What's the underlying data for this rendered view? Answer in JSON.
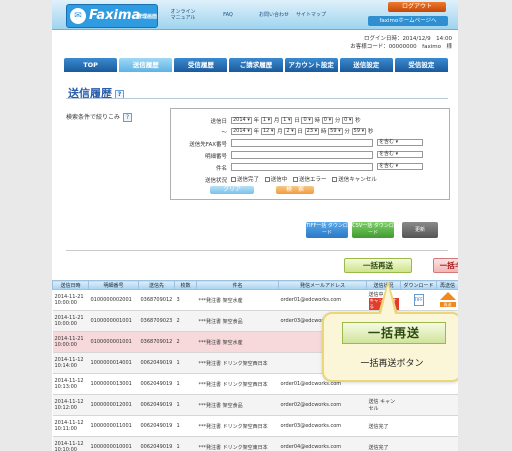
{
  "header": {
    "logo_main": "Faxima",
    "logo_sub": "管理画面",
    "nav": [
      "オンライン マニュアル",
      "FAQ",
      "お問い合わせ",
      "サイトマップ"
    ],
    "logout": "ログアウト",
    "home": "faximoホームページへ",
    "login_datetime": "ログイン日時：2014/12/9　14:00",
    "customer": "お客様コード：00000000　faximo　様"
  },
  "tabs": [
    "TOP",
    "送信履歴",
    "受信履歴",
    "ご請求履歴",
    "アカウント設定",
    "送信設定",
    "受信設定"
  ],
  "page": {
    "title": "送信履歴",
    "filter_label": "検索条件で絞りこみ"
  },
  "search": {
    "date_label": "送信日",
    "from": {
      "year": "2014",
      "month": "1",
      "day": "1",
      "hour": "0",
      "min": "0",
      "sec": "0"
    },
    "to": {
      "year": "2014",
      "month": "12",
      "day": "2",
      "hour": "23",
      "min": "59",
      "sec": "59"
    },
    "tilde": "～",
    "unit_year": "年",
    "unit_month": "月",
    "unit_day": "日",
    "unit_hour": "時",
    "unit_min": "分",
    "unit_sec": "秒",
    "fax_label": "送信先FAX番号",
    "detail_label": "明細番号",
    "subject_label": "件名",
    "contains": "を含む",
    "status_label": "送信状況",
    "statuses": [
      "送信完了",
      "送信中",
      "送信エラー",
      "送信キャンセル"
    ],
    "clear": "クリア",
    "search_btn": "検　索"
  },
  "downloads": {
    "tiff": "TIFF一括 ダウンロード",
    "csv": "CSV一括 ダウンロード",
    "refresh": "更新"
  },
  "actions": {
    "bulk_resend": "一括再送",
    "bulk_cancel": "一括キャンセル"
  },
  "table": {
    "headers": [
      "送信日時",
      "明細番号",
      "送信先",
      "枚数",
      "件名",
      "発信メールアドレス",
      "送信状況",
      "ダウンロード",
      "再送信"
    ],
    "rows": [
      {
        "date": "2014-11-21 10:00:00",
        "id": "0100000002001",
        "to": "0368709012",
        "pages": "3",
        "subject": "***発注書 架空水産",
        "mail": "order01@edcworks.com",
        "status": "送信中",
        "status_tag": "キャンセルする",
        "tiff": true,
        "resend": true,
        "hl": false
      },
      {
        "date": "2014-11-21 10:00:00",
        "id": "0100000001001",
        "to": "0368709023",
        "pages": "2",
        "subject": "***発注書 架空食品",
        "mail": "order03@edcworks.com",
        "status": "",
        "status_tag": "",
        "tiff": true,
        "resend": true,
        "hl": false
      },
      {
        "date": "2014-11-21 10:00:00",
        "id": "0100000001001",
        "to": "0368709012",
        "pages": "2",
        "subject": "***発注書 架空水産",
        "mail": "",
        "status": "",
        "status_tag": "",
        "tiff": true,
        "resend": true,
        "hl": true
      },
      {
        "date": "2014-11-12 10:14:00",
        "id": "1000000014001",
        "to": "0062049019",
        "pages": "1",
        "subject": "***発注書 ドリンク架空西日本",
        "mail": "",
        "status": "",
        "status_tag": "",
        "tiff": false,
        "resend": false,
        "hl": false
      },
      {
        "date": "2014-11-12 10:13:00",
        "id": "1000000013001",
        "to": "0062049019",
        "pages": "1",
        "subject": "***発注書 ドリンク架空西日本",
        "mail": "order01@edcworks.com",
        "status": "",
        "status_tag": "",
        "tiff": false,
        "resend": false,
        "hl": false
      },
      {
        "date": "2014-11-12 10:12:00",
        "id": "1000000012001",
        "to": "0062049019",
        "pages": "1",
        "subject": "***発注書 架空食品",
        "mail": "order02@edcworks.com",
        "status": "送信 キャンセル",
        "status_tag": "",
        "tiff": false,
        "resend": false,
        "hl": false
      },
      {
        "date": "2014-11-12 10:11:00",
        "id": "1000000011001",
        "to": "0062049019",
        "pages": "1",
        "subject": "***発注書 ドリンク架空西日本",
        "mail": "order03@edcworks.com",
        "status": "送信完了",
        "status_tag": "",
        "tiff": false,
        "resend": false,
        "hl": false
      },
      {
        "date": "2014-11-12 10:10:00",
        "id": "1000000010001",
        "to": "0062049019",
        "pages": "1",
        "subject": "***発注書 ドリンク架空東日本",
        "mail": "order04@edcworks.com",
        "status": "送信完了",
        "status_tag": "",
        "tiff": false,
        "resend": false,
        "hl": false
      }
    ],
    "tiff_label": "TIFF",
    "resend_label": "再送"
  },
  "callout": {
    "button": "一括再送",
    "caption": "一括再送ボタン"
  },
  "colors": {
    "accent": "#2a5da8",
    "tab": "#1a5a9c",
    "resend": "#f08a1c",
    "callout": "#fbf6d8"
  }
}
